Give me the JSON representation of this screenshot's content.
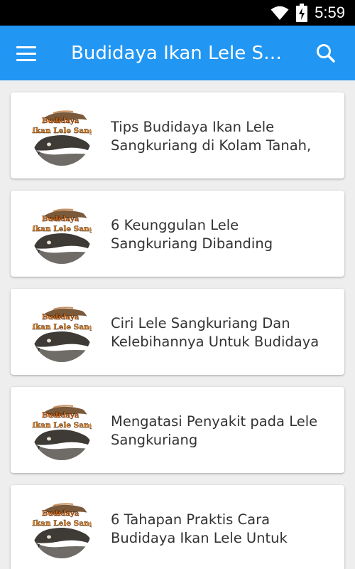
{
  "status_bar": {
    "time": "5:59",
    "icons": [
      "wifi-icon",
      "battery-charging-icon"
    ]
  },
  "app_bar": {
    "title": "Budidaya Ikan Lele Sangkuriang",
    "menu_icon": "hamburger-menu-icon",
    "search_icon": "search-icon",
    "color": "#2196f3"
  },
  "articles": [
    {
      "line1": "Tips Budidaya Ikan Lele",
      "line2": "Sangkuriang di Kolam Tanah,",
      "thumbnail_icon": "catfish-thumbnail",
      "thumbnail_text": "Budidaya Ikan Lele Sangkuriang"
    },
    {
      "line1": "6 Keunggulan Lele",
      "line2": "Sangkuriang Dibanding",
      "thumbnail_icon": "catfish-thumbnail",
      "thumbnail_text": "Budidaya Ikan Lele Sangkuriang"
    },
    {
      "line1": "Ciri Lele Sangkuriang Dan",
      "line2": "Kelebihannya Untuk Budidaya",
      "thumbnail_icon": "catfish-thumbnail",
      "thumbnail_text": "Budidaya Ikan Lele Sangkuriang"
    },
    {
      "line1": "Mengatasi Penyakit pada Lele",
      "line2": "Sangkuriang",
      "thumbnail_icon": "catfish-thumbnail",
      "thumbnail_text": "Budidaya Ikan Lele Sangkuriang"
    },
    {
      "line1": "6 Tahapan Praktis Cara",
      "line2": "Budidaya Ikan Lele Untuk",
      "thumbnail_icon": "catfish-thumbnail",
      "thumbnail_text": "Budidaya Ikan Lele Sangkuriang"
    }
  ]
}
